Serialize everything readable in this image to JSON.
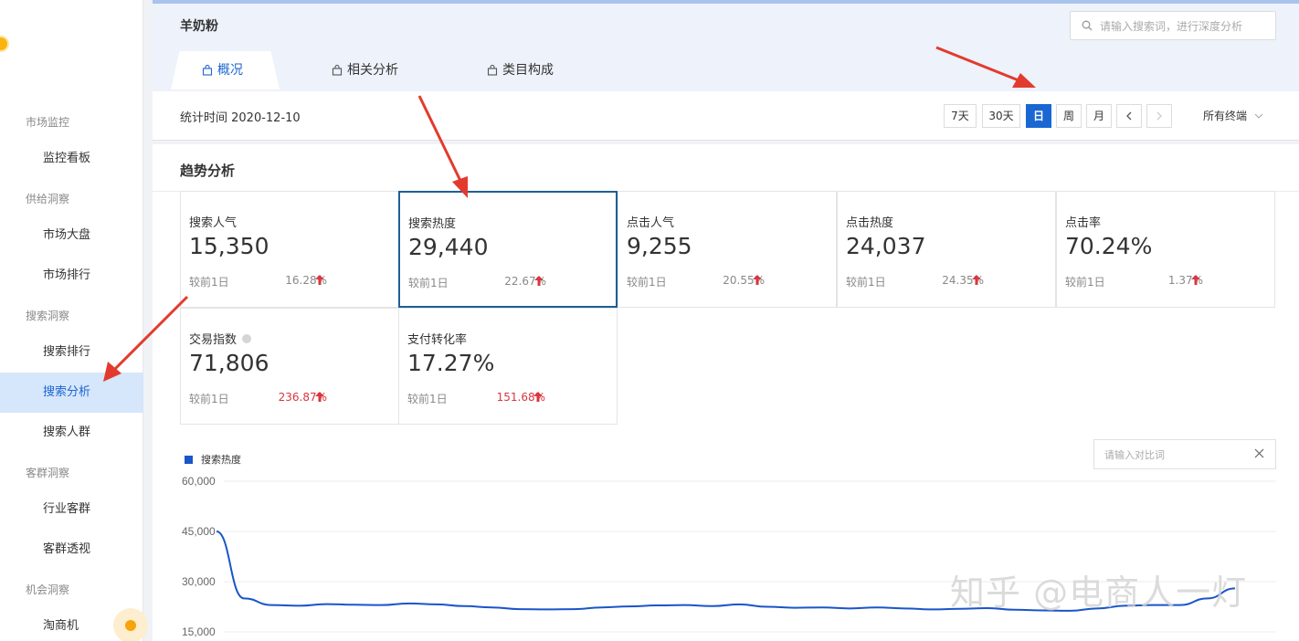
{
  "sidebar": {
    "groups": [
      {
        "label": "市场监控",
        "items": [
          {
            "label": "监控看板",
            "active": false
          }
        ]
      },
      {
        "label": "供给洞察",
        "items": [
          {
            "label": "市场大盘",
            "active": false
          },
          {
            "label": "市场排行",
            "active": false
          }
        ]
      },
      {
        "label": "搜索洞察",
        "items": [
          {
            "label": "搜索排行",
            "active": false
          },
          {
            "label": "搜索分析",
            "active": true
          },
          {
            "label": "搜索人群",
            "active": false
          }
        ]
      },
      {
        "label": "客群洞察",
        "items": [
          {
            "label": "行业客群",
            "active": false
          },
          {
            "label": "客群透视",
            "active": false
          }
        ]
      },
      {
        "label": "机会洞察",
        "items": [
          {
            "label": "淘商机",
            "active": false
          }
        ]
      }
    ]
  },
  "header": {
    "keyword": "羊奶粉",
    "search_placeholder": "请输入搜索词，进行深度分析",
    "tabs": [
      {
        "label": "概况",
        "active": true
      },
      {
        "label": "相关分析",
        "active": false
      },
      {
        "label": "类目构成",
        "active": false
      }
    ]
  },
  "toolbar": {
    "stat_time": "统计时间 2020-12-10",
    "ranges": [
      "7天",
      "30天",
      "日",
      "周",
      "月"
    ],
    "active_range": "日",
    "terminal": "所有终端"
  },
  "trend": {
    "title": "趋势分析",
    "metrics": [
      {
        "label": "搜索人气",
        "value": "15,350",
        "cmp": "较前1日",
        "pct": "16.28%",
        "highlight": false,
        "selected": false
      },
      {
        "label": "搜索热度",
        "value": "29,440",
        "cmp": "较前1日",
        "pct": "22.67%",
        "highlight": false,
        "selected": true
      },
      {
        "label": "点击人气",
        "value": "9,255",
        "cmp": "较前1日",
        "pct": "20.55%",
        "highlight": false,
        "selected": false
      },
      {
        "label": "点击热度",
        "value": "24,037",
        "cmp": "较前1日",
        "pct": "24.35%",
        "highlight": false,
        "selected": false
      },
      {
        "label": "点击率",
        "value": "70.24%",
        "cmp": "较前1日",
        "pct": "1.37%",
        "highlight": false,
        "selected": false
      },
      {
        "label": "交易指数",
        "value": "71,806",
        "cmp": "较前1日",
        "pct": "236.87%",
        "highlight": true,
        "selected": false
      },
      {
        "label": "支付转化率",
        "value": "17.27%",
        "cmp": "较前1日",
        "pct": "151.68%",
        "highlight": true,
        "selected": false
      }
    ],
    "compare_placeholder": "请输入对比词"
  },
  "chart_data": {
    "type": "line",
    "series": [
      {
        "name": "搜索热度",
        "color": "#1a55c9",
        "values": [
          45000,
          25000,
          23000,
          22800,
          23300,
          23100,
          23000,
          23500,
          23200,
          22700,
          22300,
          21800,
          21700,
          21800,
          22300,
          22600,
          22900,
          23000,
          22700,
          23200,
          22500,
          22200,
          22300,
          22000,
          22300,
          22000,
          21700,
          21900,
          22100,
          21600,
          21400,
          21300,
          22000,
          22800,
          23000,
          23000,
          25000,
          28000
        ]
      }
    ],
    "y_ticks": [
      "60,000",
      "45,000",
      "30,000",
      "15,000"
    ],
    "ylim": [
      15000,
      60000
    ],
    "grid": true,
    "legend": "top-left"
  },
  "watermark": "知乎 @电商人一灯",
  "colors": {
    "accent": "#1a66d2",
    "increase": "#d9363e",
    "selected_border": "#1f5f95"
  }
}
